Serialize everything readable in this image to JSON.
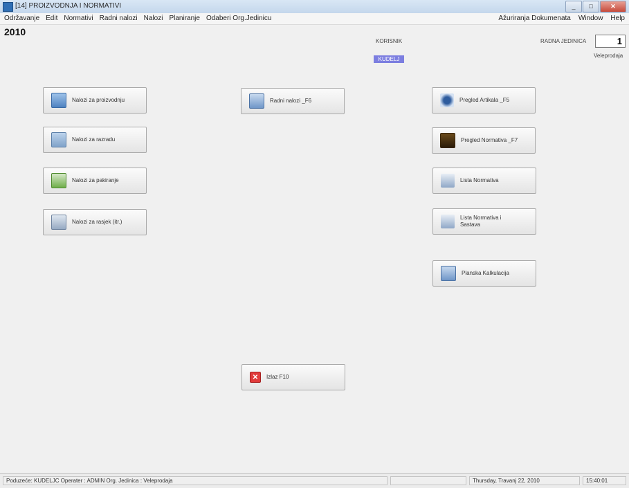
{
  "window": {
    "title": "[14] PROIZVODNJA I NORMATIVI",
    "minimize": "_",
    "maximize": "□",
    "close": "✕"
  },
  "menu": {
    "left": [
      "Održavanje",
      "Edit",
      "Normativi",
      "Radni nalozi",
      "Nalozi",
      "Planiranje",
      "Odaberi Org.Jedinicu"
    ],
    "right": [
      "Ažuriranja Dokumenata",
      "Window",
      "Help"
    ]
  },
  "header": {
    "year": "2010",
    "korisnik_label": "KORISNIK",
    "korisnik_value": "KUDELJ",
    "radna_jedinica_label": "RADNA JEDINICA",
    "radna_jedinica_value": "1",
    "radna_jedinica_name": "Veleprodaja"
  },
  "buttons": {
    "nalozi_proizvodnju": {
      "label": "Nalozi za proizvodnju",
      "icon": "document-icon"
    },
    "nalozi_razradu": {
      "label": "Nalozi za razradu",
      "icon": "cutting-icon"
    },
    "nalozi_pakiranje": {
      "label": "Nalozi za pakiranje",
      "icon": "package-icon"
    },
    "nalozi_rasjek": {
      "label": "Nalozi za rasjek (itr.)",
      "icon": "drawing-icon"
    },
    "radni_nalozi": {
      "label": "Radni nalozi _F6",
      "icon": "worksheet-icon"
    },
    "pregled_artikala": {
      "label": "Pregled Artikala _F5",
      "icon": "swirl-icon"
    },
    "pregled_normativa": {
      "label": "Pregled Normativa _F7",
      "icon": "film-icon"
    },
    "lista_normativa": {
      "label": "Lista Normativa",
      "icon": "stack-icon"
    },
    "lista_normativa_sastava_1": "Lista Normativa i",
    "lista_normativa_sastava_2": "Sastava",
    "planska_kalkulacija": {
      "label": "Planska Kalkulacija",
      "icon": "calculator-icon"
    },
    "izlaz": {
      "label": "Izlaz  F10",
      "icon": "exit-icon"
    }
  },
  "status": {
    "info": "Poduzeće: KUDELJC  Operater : ADMIN  Org. Jedinica : Veleprodaja",
    "date": "Thursday, Travanj 22, 2010",
    "time": "15:40:01"
  },
  "colors": {
    "korisnik_badge": "#7c7ee0",
    "exit_red": "#e13b3b"
  }
}
